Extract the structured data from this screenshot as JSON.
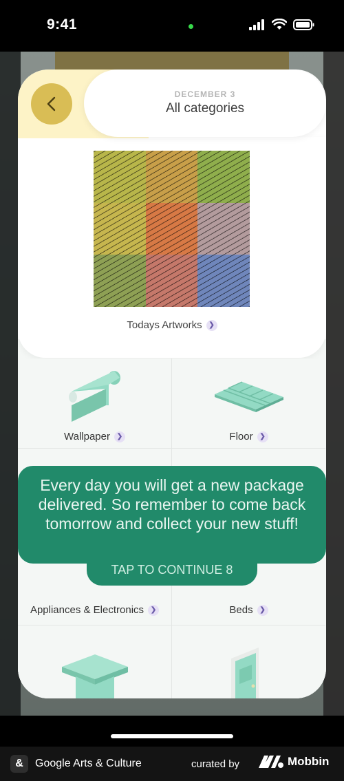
{
  "status_bar": {
    "time": "9:41"
  },
  "header": {
    "date": "DECEMBER 3",
    "title": "All categories"
  },
  "artwork": {
    "label": "Todays Artworks"
  },
  "categories": [
    {
      "label": "Wallpaper"
    },
    {
      "label": "Floor"
    },
    {
      "label": "Appliances & Electronics"
    },
    {
      "label": "Beds"
    }
  ],
  "tooltip": {
    "message": "Every day you will get a new package delivered. So remember to come back tomorrow and collect your new stuff!",
    "cta": "TAP TO CONTINUE 8"
  },
  "footer": {
    "app_name": "Google Arts & Culture",
    "curated_by": "curated by",
    "brand": "Mobbin"
  },
  "colors": {
    "accent_green": "#218a6a",
    "back_button": "#d9bd55",
    "mint": "#93dac4"
  },
  "icons": [
    "back-chevron-icon",
    "signal-icon",
    "wifi-icon",
    "battery-icon",
    "chevron-right-icon"
  ]
}
